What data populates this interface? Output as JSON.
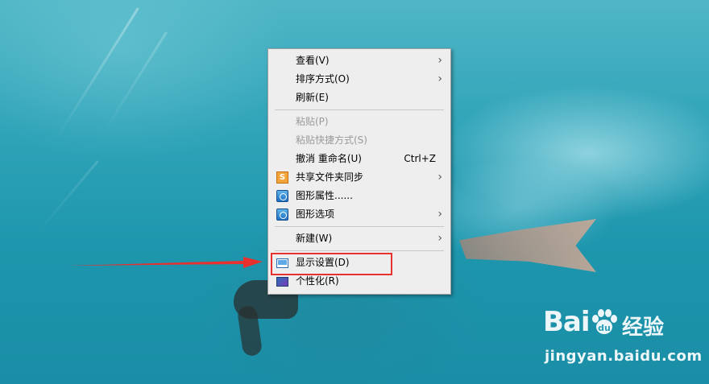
{
  "context_menu": {
    "items": [
      {
        "label": "查看(V)",
        "has_submenu": true,
        "disabled": false
      },
      {
        "label": "排序方式(O)",
        "has_submenu": true,
        "disabled": false
      },
      {
        "label": "刷新(E)",
        "has_submenu": false,
        "disabled": false
      },
      {
        "label": "粘贴(P)",
        "has_submenu": false,
        "disabled": true
      },
      {
        "label": "粘贴快捷方式(S)",
        "has_submenu": false,
        "disabled": true
      },
      {
        "label": "撤消 重命名(U)",
        "shortcut": "Ctrl+Z",
        "has_submenu": false,
        "disabled": false
      },
      {
        "label": "共享文件夹同步",
        "icon": "sync-folder-icon",
        "has_submenu": true,
        "disabled": false
      },
      {
        "label": "图形属性......",
        "icon": "graphics-properties-icon",
        "has_submenu": false,
        "disabled": false
      },
      {
        "label": "图形选项",
        "icon": "graphics-options-icon",
        "has_submenu": true,
        "disabled": false
      },
      {
        "label": "新建(W)",
        "has_submenu": true,
        "disabled": false
      },
      {
        "label": "显示设置(D)",
        "icon": "display-settings-icon",
        "has_submenu": false,
        "disabled": false,
        "highlighted": true
      },
      {
        "label": "个性化(R)",
        "icon": "personalize-icon",
        "has_submenu": false,
        "disabled": false
      }
    ],
    "submenu_arrow": "›",
    "sync_icon_glyph": "S"
  },
  "annotation": {
    "highlight_color": "#e8312f",
    "arrow_color": "#e8312f"
  },
  "watermark": {
    "brand": "Bai",
    "brand_suffix": "经验",
    "url": "jingyan.baidu.com"
  }
}
